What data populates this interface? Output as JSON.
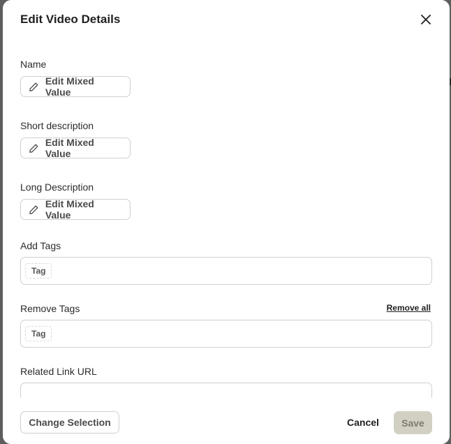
{
  "modal": {
    "title": "Edit Video Details",
    "close_icon": "close-icon"
  },
  "fields": {
    "name": {
      "label": "Name",
      "button_label": "Edit Mixed Value",
      "icon": "pencil-icon"
    },
    "short_description": {
      "label": "Short description",
      "button_label": "Edit Mixed Value",
      "icon": "pencil-icon"
    },
    "long_description": {
      "label": "Long Description",
      "button_label": "Edit Mixed Value",
      "icon": "pencil-icon"
    },
    "add_tags": {
      "label": "Add Tags",
      "tag_placeholder": "Tag"
    },
    "remove_tags": {
      "label": "Remove Tags",
      "remove_all_label": "Remove all",
      "tag_placeholder": "Tag"
    },
    "related_link_url": {
      "label": "Related Link URL",
      "value": ""
    }
  },
  "footer": {
    "change_selection_label": "Change Selection",
    "cancel_label": "Cancel",
    "save_label": "Save"
  },
  "colors": {
    "save_bg": "#d2d0c3",
    "save_text": "#7d7b70",
    "border": "#cfcfcf"
  }
}
